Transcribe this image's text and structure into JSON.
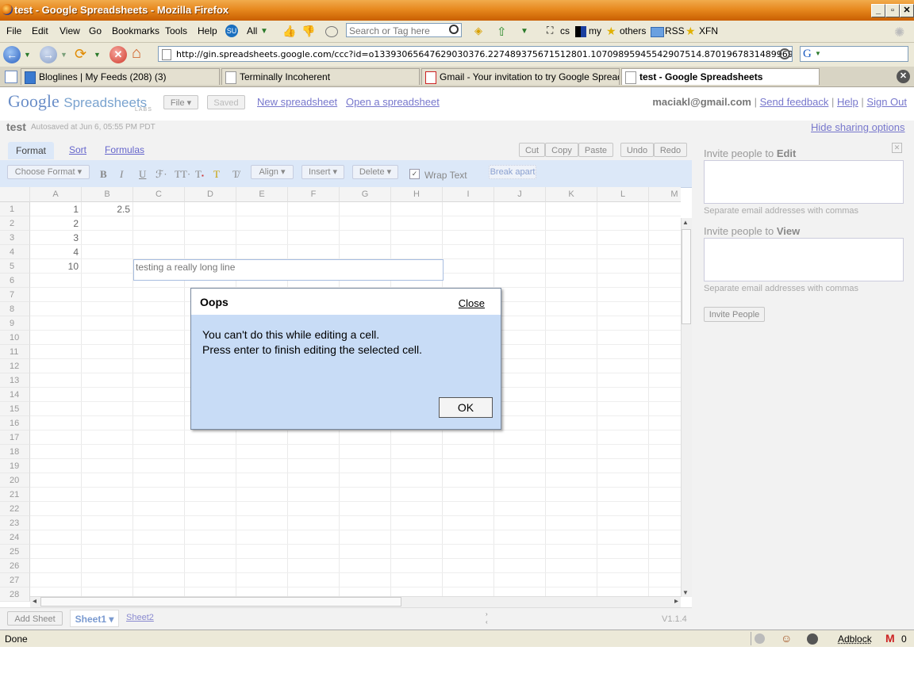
{
  "window": {
    "title": "test - Google Spreadsheets - Mozilla Firefox"
  },
  "menubar": {
    "items": [
      "File",
      "Edit",
      "View",
      "Go",
      "Bookmarks",
      "Tools",
      "Help"
    ],
    "all_label": "All",
    "search_placeholder": "Search or Tag here",
    "bookmarks": [
      "cs",
      "my",
      "others",
      "RSS",
      "XFN"
    ]
  },
  "navbar": {
    "url": "http://gin.spreadsheets.google.com/ccc?id=o13393065647629030376.227489375671512801.10709895945542907514.8701967831489969427#"
  },
  "tabs": [
    {
      "label": "Bloglines | My Feeds (208) (3)"
    },
    {
      "label": "Terminally Incoherent"
    },
    {
      "label": "Gmail - Your invitation to try Google Spread..."
    },
    {
      "label": "test - Google Spreadsheets"
    }
  ],
  "header": {
    "logo_text": "Google",
    "product": "Spreadsheets",
    "labs": "LABS",
    "file_btn": "File ▾",
    "saved_btn": "Saved",
    "new_link": "New spreadsheet",
    "open_link": "Open a spreadsheet",
    "email": "maciakl@gmail.com",
    "send_feedback": "Send feedback",
    "help": "Help",
    "sign_out": "Sign Out",
    "sep": "|"
  },
  "doc": {
    "title": "test",
    "autosave": "Autosaved at Jun 6, 05:55 PM PDT",
    "hide_sharing": "Hide sharing options"
  },
  "toolbar": {
    "tabs": [
      "Format",
      "Sort",
      "Formulas"
    ],
    "edit_buttons": [
      "Cut",
      "Copy",
      "Paste",
      "Undo",
      "Redo"
    ],
    "choose_format": "Choose Format ▾",
    "align": "Align ▾",
    "insert": "Insert ▾",
    "delete": "Delete ▾",
    "wrap_text": "Wrap Text",
    "break_apart": "Break apart"
  },
  "grid": {
    "columns": [
      "A",
      "B",
      "C",
      "D",
      "E",
      "F",
      "G",
      "H",
      "I",
      "J",
      "K",
      "L",
      "M"
    ],
    "rows": [
      "1",
      "2",
      "3",
      "4",
      "5",
      "6",
      "7",
      "8",
      "9",
      "10",
      "11",
      "12",
      "13",
      "14",
      "15",
      "16",
      "17",
      "18",
      "19",
      "20",
      "21",
      "22",
      "23",
      "24",
      "25",
      "26",
      "27",
      "28"
    ],
    "cells": {
      "A1": "1",
      "B1": "2.5",
      "A2": "2",
      "A3": "3",
      "A4": "4",
      "A5": "10"
    },
    "editing_text": "testing a really long line"
  },
  "sheetbar": {
    "add_sheet": "Add Sheet",
    "sheet1": "Sheet1 ▾",
    "sheet2": "Sheet2",
    "version": "V1.1.4"
  },
  "sidebar": {
    "invite_edit_prefix": "Invite people to",
    "invite_edit_strong": "Edit",
    "invite_view_prefix": "Invite people to",
    "invite_view_strong": "View",
    "hint": "Separate email addresses with commas",
    "invite_button": "Invite People"
  },
  "dialog": {
    "title": "Oops",
    "close": "Close",
    "line1": "You can't do this while editing a cell.",
    "line2": "Press enter to finish editing the selected cell.",
    "ok": "OK"
  },
  "statusbar": {
    "text": "Done",
    "adblock": "Adblock",
    "gmail_count": "0"
  }
}
